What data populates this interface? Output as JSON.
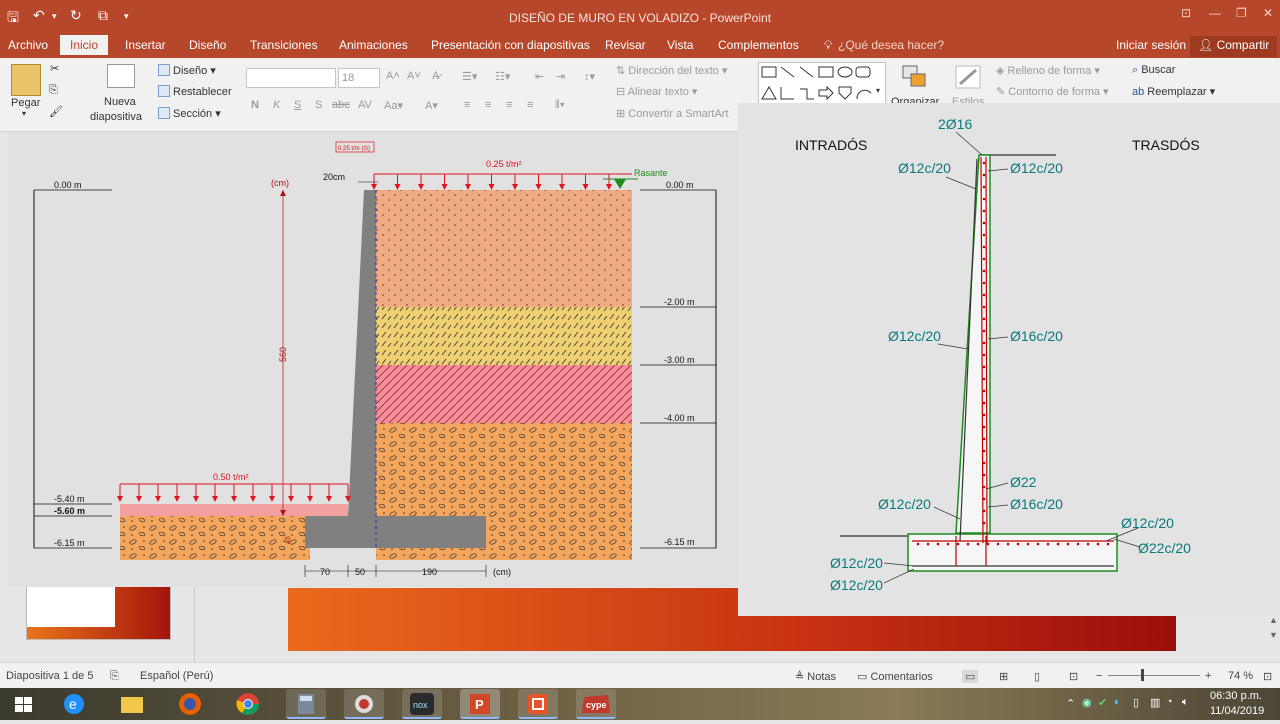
{
  "window": {
    "title": "DISEÑO DE MURO EN VOLADIZO - PowerPoint",
    "controls": [
      "⊡",
      "—",
      "❐",
      "✕"
    ]
  },
  "menu": {
    "tabs": [
      "Archivo",
      "Inicio",
      "Insertar",
      "Diseño",
      "Transiciones",
      "Animaciones",
      "Presentación con diapositivas",
      "Revisar",
      "Vista",
      "Complementos"
    ],
    "tell_me": "¿Qué desea hacer?",
    "sign_in": "Iniciar sesión",
    "share": "Compartir"
  },
  "ribbon": {
    "paste": "Pegar",
    "new_slide": "Nueva",
    "new_slide2": "diapositiva",
    "layout": "Diseño",
    "reset": "Restablecer",
    "section": "Sección",
    "font_size": "18",
    "text_direction": "Dirección del texto",
    "align_text": "Alinear texto",
    "convert_smartart": "Convertir a SmartArt",
    "organize": "Organizar",
    "styles": "Estilos",
    "shape_fill": "Relleno de forma",
    "shape_outline": "Contorno de forma",
    "find": "Buscar",
    "replace": "Reemplazar"
  },
  "drawing_left": {
    "scale_tag": "0.25 t/m (G)",
    "load_top": "0.25 t/m²",
    "rasante": "Rasante",
    "crown": "20cm",
    "unit": "(cm)",
    "height": "560",
    "toe_h": "45",
    "load_bottom": "0.50 t/m²",
    "left_levels": [
      "0.00 m",
      "-5.40 m",
      "-5.60 m",
      "-6.15 m"
    ],
    "right_levels": [
      "0.00 m",
      "-2.00 m",
      "-3.00 m",
      "-4.00 m",
      "-6.15 m"
    ],
    "dims": [
      "70",
      "50",
      "190",
      "(cm)"
    ]
  },
  "drawing_right": {
    "intrados": "INTRADÓS",
    "trasdos": "TRASDÓS",
    "labels": [
      "2Ø16",
      "Ø12c/20",
      "Ø12c/20",
      "Ø12c/20",
      "Ø16c/20",
      "Ø22",
      "Ø16c/20",
      "Ø12c/20",
      "Ø12c/20",
      "Ø22c/20",
      "Ø12c/20",
      "Ø12c/20"
    ]
  },
  "status": {
    "slide": "Diapositiva 1 de 5",
    "language": "Español (Perú)",
    "notes": "Notas",
    "comments": "Comentarios",
    "zoom": "74 %"
  },
  "taskbar": {
    "time": "06:30 p.m.",
    "date": "11/04/2019"
  },
  "colors": {
    "accent": "#b7472a",
    "soil1": "#f0ab82",
    "soil2": "#efd070",
    "soil3": "#f2909a",
    "soil4": "#f5a65d",
    "concrete": "#808080",
    "rebar_green": "#1d8c1d",
    "load_red": "#e0141e",
    "label_teal": "#0a7a7a"
  }
}
